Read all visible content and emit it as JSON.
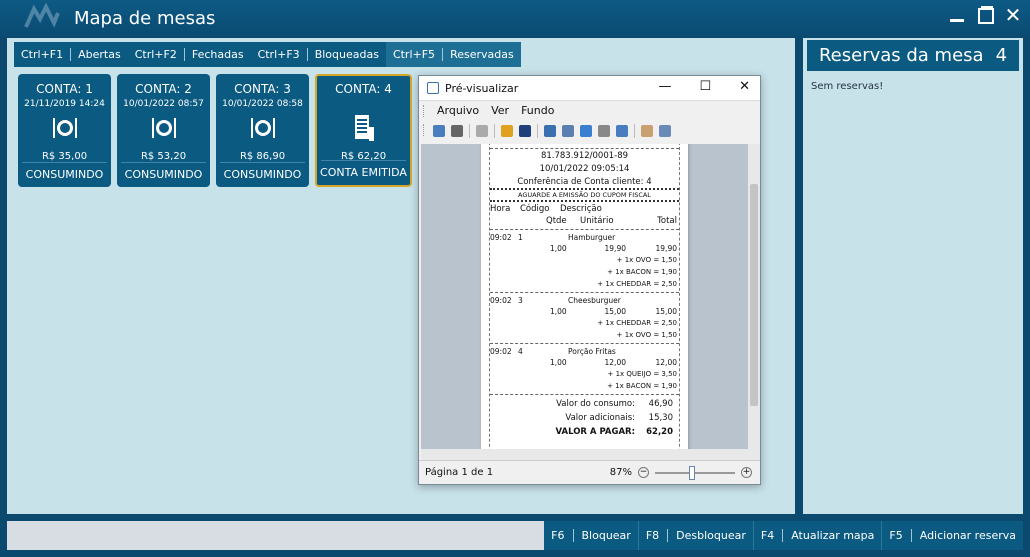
{
  "window": {
    "title": "Mapa de mesas"
  },
  "tabs": [
    {
      "key": "Ctrl+F1",
      "label": "Abertas"
    },
    {
      "key": "Ctrl+F2",
      "label": "Fechadas"
    },
    {
      "key": "Ctrl+F3",
      "label": "Bloqueadas"
    },
    {
      "key": "Ctrl+F5",
      "label": "Reservadas"
    }
  ],
  "cards": [
    {
      "title": "CONTA: 1",
      "date": "21/11/2019 14:24",
      "icon": "dining-icon",
      "value": "R$ 35,00",
      "status": "CONSUMINDO"
    },
    {
      "title": "CONTA: 2",
      "date": "10/01/2022 08:57",
      "icon": "dining-icon",
      "value": "R$ 53,20",
      "status": "CONSUMINDO"
    },
    {
      "title": "CONTA: 3",
      "date": "10/01/2022 08:58",
      "icon": "dining-icon",
      "value": "R$ 86,90",
      "status": "CONSUMINDO"
    },
    {
      "title": "CONTA: 4",
      "date": "",
      "icon": "receipt-icon",
      "value": "R$ 62,20",
      "status": "CONTA EMITIDA"
    }
  ],
  "reservations": {
    "title": "Reservas da mesa",
    "number": "4",
    "empty_text": "Sem reservas!"
  },
  "bottom_buttons": [
    {
      "key": "F6",
      "label": "Bloquear"
    },
    {
      "key": "F8",
      "label": "Desbloquear"
    },
    {
      "key": "F4",
      "label": "Atualizar mapa"
    },
    {
      "key": "F5",
      "label": "Adicionar reserva"
    }
  ],
  "preview": {
    "title": "Pré-visualizar",
    "menu": [
      "Arquivo",
      "Ver",
      "Fundo"
    ],
    "receipt": {
      "cnpj": "81.783.912/0001-89",
      "datetime": "10/01/2022 09:05:14",
      "heading": "Conferência de Conta cliente: 4",
      "notice": "AGUARDE A EMISSÃO DO CUPOM FISCAL",
      "col_hora": "Hora",
      "col_codigo": "Código",
      "col_descricao": "Descrição",
      "col_qtde": "Qtde",
      "col_unitario": "Unitário",
      "col_total": "Total",
      "items": [
        {
          "time": "09:02",
          "code": "1",
          "name": "Hamburguer",
          "qty": "1,00",
          "unit": "19,90",
          "total": "19,90",
          "additions": [
            "+ 1x OVO = 1,50",
            "+ 1x BACON = 1,90",
            "+ 1x CHEDDAR = 2,50"
          ]
        },
        {
          "time": "09:02",
          "code": "3",
          "name": "Cheesburguer",
          "qty": "1,00",
          "unit": "15,00",
          "total": "15,00",
          "additions": [
            "+ 1x CHEDDAR = 2,50",
            "+ 1x OVO = 1,50"
          ]
        },
        {
          "time": "09:02",
          "code": "4",
          "name": "Porção Fritas",
          "qty": "1,00",
          "unit": "12,00",
          "total": "12,00",
          "additions": [
            "+ 1x QUEIJO = 3,50",
            "+ 1x BACON = 1,90"
          ]
        }
      ],
      "consumo_label": "Valor do consumo:",
      "consumo": "46,90",
      "adicionais_label": "Valor adicionais:",
      "adicionais": "15,30",
      "pagar_label": "VALOR A PAGAR:",
      "pagar": "62,20"
    },
    "page_status": "Página 1 de 1",
    "zoom": "87%"
  }
}
